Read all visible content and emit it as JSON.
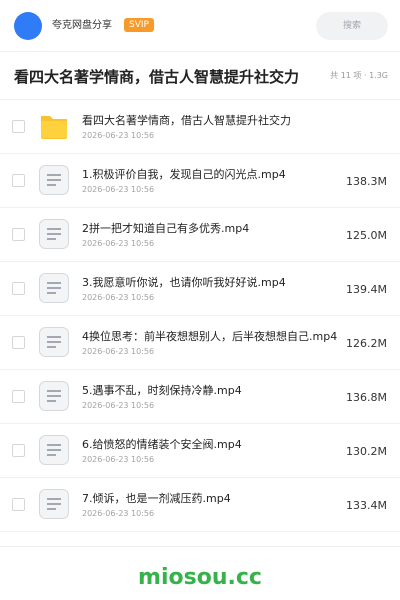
{
  "header": {
    "brand": "夸克网盘分享",
    "badge": "SVIP",
    "search_placeholder": "搜索"
  },
  "share": {
    "title": "看四大名著学情商，借古人智慧提升社交力",
    "meta": "共 11 项 · 1.3G"
  },
  "files": [
    {
      "icon": "folder-icon",
      "name": "看四大名著学情商，借古人智慧提升社交力",
      "date": "2026-06-23 10:56",
      "size": ""
    },
    {
      "icon": "document-icon",
      "name": "1.积极评价自我，发现自己的闪光点.mp4",
      "date": "2026-06-23 10:56",
      "size": "138.3M"
    },
    {
      "icon": "document-icon",
      "name": "2拼一把才知道自己有多优秀.mp4",
      "date": "2026-06-23 10:56",
      "size": "125.0M"
    },
    {
      "icon": "document-icon",
      "name": "3.我愿意听你说，也请你听我好好说.mp4",
      "date": "2026-06-23 10:56",
      "size": "139.4M"
    },
    {
      "icon": "document-icon",
      "name": "4换位思考：前半夜想想别人，后半夜想想自己.mp4",
      "date": "2026-06-23 10:56",
      "size": "126.2M"
    },
    {
      "icon": "document-icon",
      "name": "5.遇事不乱，时刻保持冷静.mp4",
      "date": "2026-06-23 10:56",
      "size": "136.8M"
    },
    {
      "icon": "document-icon",
      "name": "6.给愤怒的情绪装个安全阀.mp4",
      "date": "2026-06-23 10:56",
      "size": "130.2M"
    },
    {
      "icon": "document-icon",
      "name": "7.倾诉，也是一剂减压药.mp4",
      "date": "2026-06-23 10:56",
      "size": "133.4M"
    }
  ],
  "watermark": "miosou.cc",
  "colors": {
    "accent": "#2f7cf6",
    "badge": "#f89a2a",
    "watermark": "#35b34a",
    "folder": "#f7c22d"
  }
}
